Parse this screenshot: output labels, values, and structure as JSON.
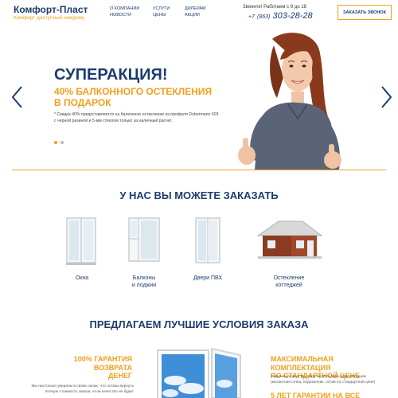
{
  "header": {
    "logo_title": "Комфорт-Пласт",
    "logo_subtitle": "Комфорт доступный каждому",
    "nav": [
      {
        "line1": "О компании",
        "line2": "Новости"
      },
      {
        "line1": "Услуги",
        "line2": "Цены"
      },
      {
        "line1": "Дилерам",
        "line2": "Акции"
      }
    ],
    "call_note": "Звоните! Работаем с 9 до 18",
    "phone_prefix": "+7",
    "phone_code": "(863)",
    "phone_number": "303-28-28",
    "callback_label": "ЗАКАЗАТЬ ЗВОНОК"
  },
  "hero": {
    "title": "СУПЕРАКЦИЯ!",
    "subtitle_line1": "40% БАЛКОННОГО ОСТЕКЛЕНИЯ",
    "subtitle_line2": "В ПОДАРОК",
    "note": "* Скидка 40% предоставляется на балконное остекление из профиля Dobermann 603 с черной резиной и 5-мм стеклом только за наличный расчет.",
    "slide_count": 2,
    "active_slide": 1
  },
  "services": {
    "title": "У НАС ВЫ МОЖЕТЕ ЗАКАЗАТЬ",
    "items": [
      {
        "line1": "Окна",
        "line2": ""
      },
      {
        "line1": "Балконы",
        "line2": "и лоджии"
      },
      {
        "line1": "Двери ПВХ",
        "line2": ""
      },
      {
        "line1": "Остекление",
        "line2": "коттеджей"
      }
    ]
  },
  "conditions": {
    "title": "ПРЕДЛАГАЕМ ЛУЧШИЕ УСЛОВИЯ ЗАКАЗА",
    "left_title_line1": "100% ГАРАНТИЯ",
    "left_title_line2": "ВОЗВРАТА",
    "left_title_line3": "ДЕНЕГ",
    "left_text_line1": "Мы настолько уверены в своих окнах, что готовы вернуть",
    "left_text_line2": "полную стоимость заказа, если качество не будет",
    "right_title_line1": "МАКСИМАЛЬНАЯ КОМПЛЕКТАЦИЯ",
    "right_title_line2": "ПО СТАНДАРТНОЙ ЦЕНЕ",
    "right_text_line1": "Заказывая окна, Вы получаете полную комплектацию",
    "right_text_line2": "(москитная сетка, подоконник, отлив по стандартной цене)",
    "right_title2": "5 ЛЕТ ГАРАНТИИ НА ВСЕ"
  },
  "colors": {
    "brand_blue": "#1d3c6e",
    "accent_orange": "#f29f1b"
  }
}
